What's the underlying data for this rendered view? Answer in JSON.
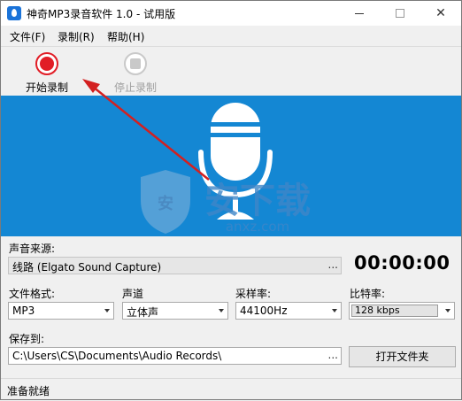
{
  "window": {
    "title": "神奇MP3录音软件 1.0 - 试用版",
    "minimize_symbol": "",
    "close_symbol": "✕"
  },
  "menu": {
    "items": [
      {
        "label": "文件(F)"
      },
      {
        "label": "录制(R)"
      },
      {
        "label": "帮助(H)"
      }
    ]
  },
  "toolbar": {
    "record_label": "开始录制",
    "stop_label": "停止录制"
  },
  "banner": {
    "watermark_text": "安下载",
    "watermark_sub": "anxz.com",
    "colors": {
      "background": "#1487d3",
      "arrow": "#d32020"
    }
  },
  "source": {
    "label": "声音来源:",
    "value": "线路 (Elgato Sound Capture)",
    "browse": "..."
  },
  "timer": "00:00:00",
  "format": {
    "label": "文件格式:",
    "value": "MP3"
  },
  "channel": {
    "label": "声道",
    "value": "立体声"
  },
  "samplerate": {
    "label": "采样率:",
    "value": "44100Hz"
  },
  "bitrate": {
    "label": "比特率:",
    "value": "128 kbps"
  },
  "save": {
    "label": "保存到:",
    "path": "C:\\Users\\CS\\Documents\\Audio Records\\",
    "browse": "...",
    "open_folder": "打开文件夹"
  },
  "status": "准备就绪"
}
